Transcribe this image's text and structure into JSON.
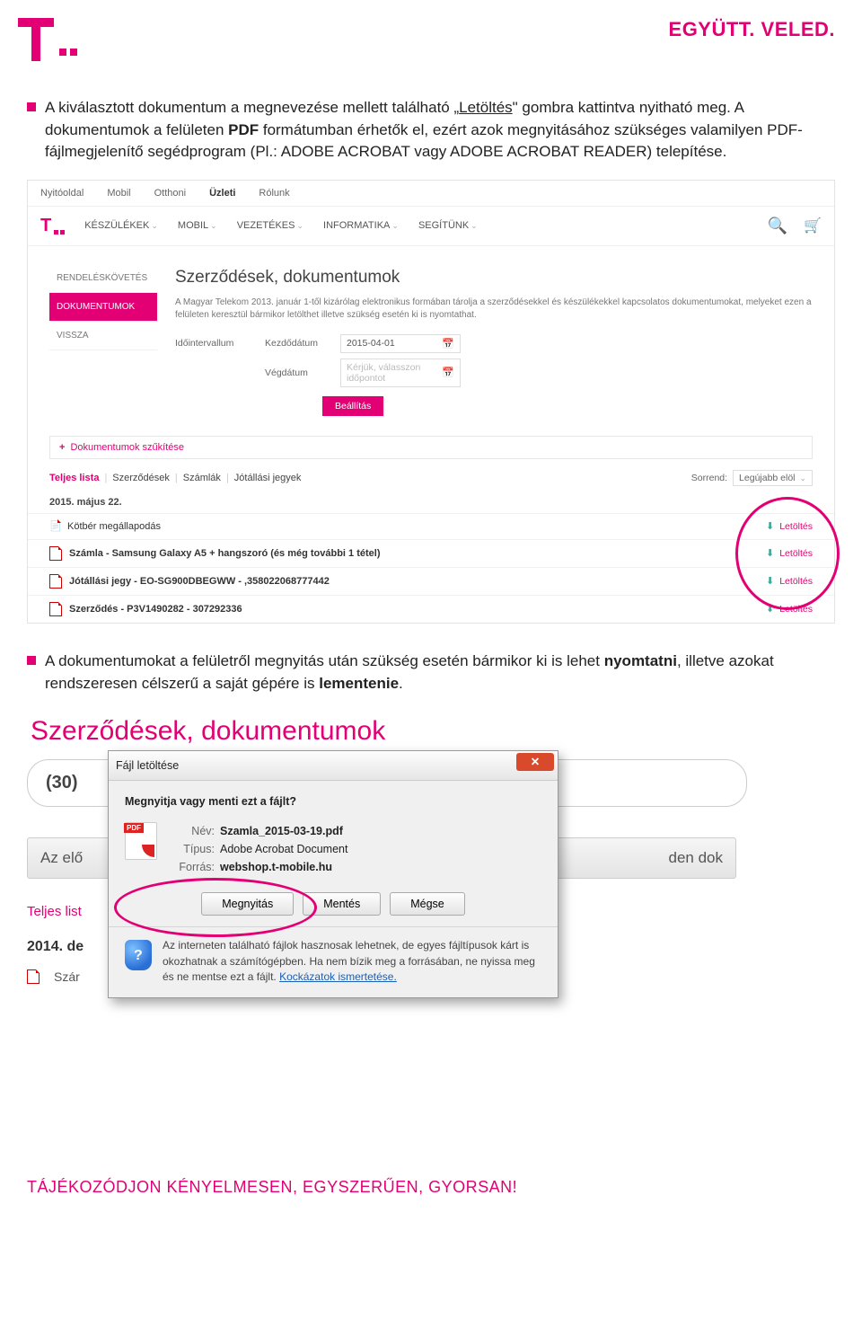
{
  "header": {
    "slogan": "EGYÜTT. VELED."
  },
  "paragraph1": {
    "pre": "A kiválasztott dokumentum a megnevezése mellett található „",
    "link": "Letöltés",
    "mid": "\" gombra kattintva nyitható meg. A dokumentumok a felületen ",
    "bold1": "PDF",
    "tail": " formátumban érhetők el, ezért azok megnyitásához szükséges valamilyen PDF-fájlmegjelenítő segédprogram (Pl.: ADOBE ACROBAT vagy ADOBE ACROBAT READER) telepítése."
  },
  "shot1": {
    "topnav": [
      "Nyitóoldal",
      "Mobil",
      "Otthoni",
      "Üzleti",
      "Rólunk"
    ],
    "mainnav": [
      "KÉSZÜLÉKEK",
      "MOBIL",
      "VEZETÉKES",
      "INFORMATIKA",
      "SEGÍTÜNK"
    ],
    "sidebar": {
      "item1": "RENDELÉSKÖVETÉS",
      "item2": "DOKUMENTUMOK",
      "item3": "VISSZA"
    },
    "title": "Szerződések, dokumentumok",
    "desc": "A Magyar Telekom 2013. január 1-től kizárólag elektronikus formában tárolja a szerződésekkel és készülékekkel kapcsolatos dokumentumokat, melyeket ezen a felületen keresztül bármikor letölthet illetve szükség esetén ki is nyomtathat.",
    "interval_label": "Időintervallum",
    "start_label": "Kezdődátum",
    "start_value": "2015-04-01",
    "end_label": "Végdátum",
    "end_placeholder": "Kérjük, válasszon időpontot",
    "set_btn": "Beállítás",
    "filter": "Dokumentumok szűkítése",
    "tabs": {
      "t1": "Teljes lista",
      "t2": "Szerződések",
      "t3": "Számlák",
      "t4": "Jótállási jegyek"
    },
    "sort_label": "Sorrend:",
    "sort_value": "Legújabb elöl",
    "date": "2015. május 22.",
    "rows": [
      "Kötbér megállapodás",
      "Számla - Samsung Galaxy A5 + hangszoró (és még további 1 tétel)",
      "Jótállási jegy - EO-SG900DBEGWW - ,358022068777442",
      "Szerződés - P3V1490282 - 307292336"
    ],
    "download": "Letöltés"
  },
  "paragraph2": {
    "pre": "A dokumentumokat a felületről megnyitás után szükség esetén bármikor ki is lehet ",
    "b1": "nyomtatni",
    "mid": ", illetve azokat rendszeresen célszerű a saját gépére is ",
    "b2": "lementenie",
    "tail": "."
  },
  "shot2": {
    "bg_title": "Szerződések, dokumentumok",
    "bg_count": "(30)",
    "bg_bar_left": "Az elő",
    "bg_bar_right": "den dok",
    "bg_tab": "Teljes list",
    "bg_date": "2014. de",
    "bg_doc": "Szár",
    "dlg_title": "Fájl letöltése",
    "dlg_q": "Megnyitja vagy menti ezt a fájlt?",
    "name_l": "Név:",
    "name_v": "Szamla_2015-03-19.pdf",
    "type_l": "Típus:",
    "type_v": "Adobe Acrobat Document",
    "src_l": "Forrás:",
    "src_v": "webshop.t-mobile.hu",
    "btn_open": "Megnyitás",
    "btn_save": "Mentés",
    "btn_cancel": "Mégse",
    "warn": "Az interneten található fájlok hasznosak lehetnek, de egyes fájltípusok kárt is okozhatnak a számítógépben. Ha nem bízik meg a forrásában, ne nyissa meg és ne mentse ezt a fájlt. ",
    "warn_link": "Kockázatok ismertetése."
  },
  "footer": "TÁJÉKOZÓDJON KÉNYELMESEN, EGYSZERŰEN, GYORSAN!"
}
